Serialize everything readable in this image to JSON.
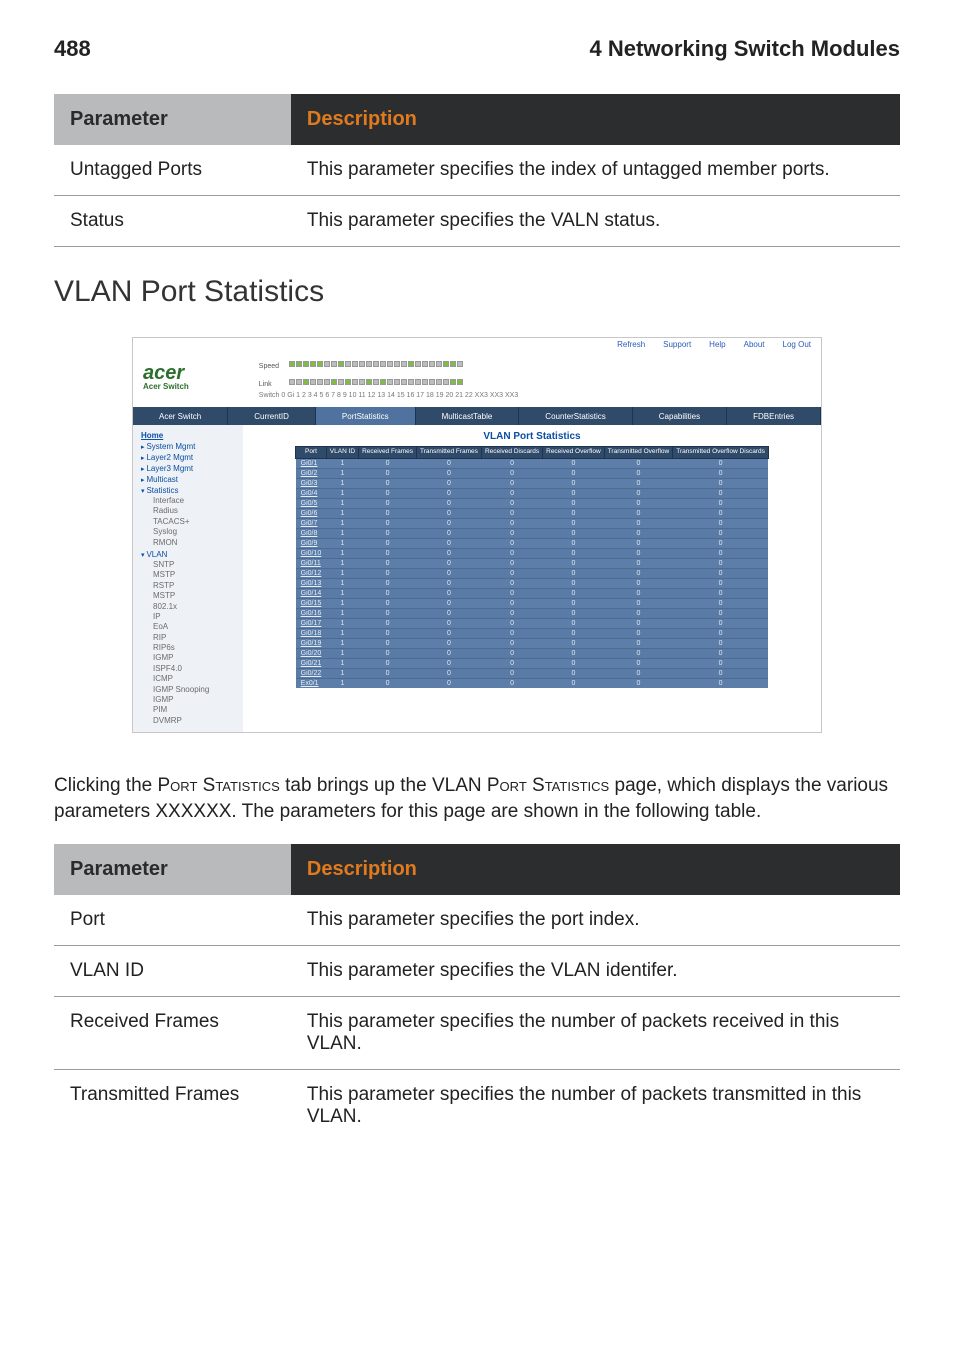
{
  "header": {
    "page_no": "488",
    "chapter": "4 Networking Switch Modules"
  },
  "table1": {
    "head_param": "Parameter",
    "head_desc": "Description",
    "rows": [
      {
        "param": "Untagged Ports",
        "desc": "This parameter specifies the index of untagged member ports."
      },
      {
        "param": "Status",
        "desc": "This parameter specifies the VALN status."
      }
    ]
  },
  "section_heading": "VLAN Port Statistics",
  "shot": {
    "toplinks": [
      {
        "label": "Refresh"
      },
      {
        "label": "Support"
      },
      {
        "label": "Help"
      },
      {
        "label": "About"
      },
      {
        "label": "Log Out"
      }
    ],
    "brand": "acer",
    "brand_sub": "Acer Switch",
    "pp_labels": {
      "speed": "Speed",
      "link": "Link"
    },
    "switch_line": "Switch 0 Gi 1 2 3 4 5 6 7 8 9 10 11 12 13 14 15 16 17 18 19 20 21 22 XX3 XX3 XX3",
    "tabs": [
      "Acer Switch",
      "CurrentID",
      "PortStatistics",
      "MulticastTable",
      "CounterStatistics",
      "Capabilities",
      "FDBEntries"
    ],
    "sidebar": {
      "home": "Home",
      "groups": [
        {
          "label": "System Mgmt"
        },
        {
          "label": "Layer2 Mgmt"
        },
        {
          "label": "Layer3 Mgmt"
        },
        {
          "label": "Multicast"
        },
        {
          "label": "Statistics",
          "open": true,
          "items": [
            "Interface",
            "Radius",
            "TACACS+",
            "Syslog",
            "RMON"
          ]
        },
        {
          "label": "VLAN",
          "open": true,
          "items": [
            "SNTP",
            "MSTP",
            "RSTP",
            "MSTP",
            "802.1x",
            "IP",
            "EoA",
            "RIP",
            "RIP6s",
            "IGMP",
            "ISPF4.0",
            "ICMP",
            "IGMP Snooping",
            "IGMP",
            "PIM",
            "DVMRP"
          ]
        }
      ]
    },
    "main": {
      "title": "VLAN Port Statistics",
      "headers": [
        "Port",
        "VLAN ID",
        "Received Frames",
        "Transmitted Frames",
        "Received Discards",
        "Received Overflow",
        "Transmitted Overflow",
        "Transmitted Overflow Discards"
      ],
      "rows": [
        {
          "port": "Gi0/1",
          "id": "1",
          "v": [
            "0",
            "0",
            "0",
            "0",
            "0",
            "0"
          ]
        },
        {
          "port": "Gi0/2",
          "id": "1",
          "v": [
            "0",
            "0",
            "0",
            "0",
            "0",
            "0"
          ]
        },
        {
          "port": "Gi0/3",
          "id": "1",
          "v": [
            "0",
            "0",
            "0",
            "0",
            "0",
            "0"
          ]
        },
        {
          "port": "Gi0/4",
          "id": "1",
          "v": [
            "0",
            "0",
            "0",
            "0",
            "0",
            "0"
          ]
        },
        {
          "port": "Gi0/5",
          "id": "1",
          "v": [
            "0",
            "0",
            "0",
            "0",
            "0",
            "0"
          ]
        },
        {
          "port": "Gi0/6",
          "id": "1",
          "v": [
            "0",
            "0",
            "0",
            "0",
            "0",
            "0"
          ]
        },
        {
          "port": "Gi0/7",
          "id": "1",
          "v": [
            "0",
            "0",
            "0",
            "0",
            "0",
            "0"
          ]
        },
        {
          "port": "Gi0/8",
          "id": "1",
          "v": [
            "0",
            "0",
            "0",
            "0",
            "0",
            "0"
          ]
        },
        {
          "port": "Gi0/9",
          "id": "1",
          "v": [
            "0",
            "0",
            "0",
            "0",
            "0",
            "0"
          ]
        },
        {
          "port": "Gi0/10",
          "id": "1",
          "v": [
            "0",
            "0",
            "0",
            "0",
            "0",
            "0"
          ]
        },
        {
          "port": "Gi0/11",
          "id": "1",
          "v": [
            "0",
            "0",
            "0",
            "0",
            "0",
            "0"
          ]
        },
        {
          "port": "Gi0/12",
          "id": "1",
          "v": [
            "0",
            "0",
            "0",
            "0",
            "0",
            "0"
          ]
        },
        {
          "port": "Gi0/13",
          "id": "1",
          "v": [
            "0",
            "0",
            "0",
            "0",
            "0",
            "0"
          ]
        },
        {
          "port": "Gi0/14",
          "id": "1",
          "v": [
            "0",
            "0",
            "0",
            "0",
            "0",
            "0"
          ]
        },
        {
          "port": "Gi0/15",
          "id": "1",
          "v": [
            "0",
            "0",
            "0",
            "0",
            "0",
            "0"
          ]
        },
        {
          "port": "Gi0/16",
          "id": "1",
          "v": [
            "0",
            "0",
            "0",
            "0",
            "0",
            "0"
          ]
        },
        {
          "port": "Gi0/17",
          "id": "1",
          "v": [
            "0",
            "0",
            "0",
            "0",
            "0",
            "0"
          ]
        },
        {
          "port": "Gi0/18",
          "id": "1",
          "v": [
            "0",
            "0",
            "0",
            "0",
            "0",
            "0"
          ]
        },
        {
          "port": "Gi0/19",
          "id": "1",
          "v": [
            "0",
            "0",
            "0",
            "0",
            "0",
            "0"
          ]
        },
        {
          "port": "Gi0/20",
          "id": "1",
          "v": [
            "0",
            "0",
            "0",
            "0",
            "0",
            "0"
          ]
        },
        {
          "port": "Gi0/21",
          "id": "1",
          "v": [
            "0",
            "0",
            "0",
            "0",
            "0",
            "0"
          ]
        },
        {
          "port": "Gi0/22",
          "id": "1",
          "v": [
            "0",
            "0",
            "0",
            "0",
            "0",
            "0"
          ]
        },
        {
          "port": "Ex0/1",
          "id": "1",
          "v": [
            "0",
            "0",
            "0",
            "0",
            "0",
            "0"
          ]
        }
      ]
    }
  },
  "body_para": {
    "pre": "Clicking the ",
    "sc1": "Port Statistics",
    "mid1": " tab brings up the VLAN ",
    "sc2": "Port Statistics",
    "post": " page, which displays the various parameters XXXXXX. The parameters for this page are shown in the following table."
  },
  "table2": {
    "head_param": "Parameter",
    "head_desc": "Description",
    "rows": [
      {
        "param": "Port",
        "desc": "This parameter specifies the port index."
      },
      {
        "param": "VLAN ID",
        "desc": "This parameter specifies the VLAN identifer."
      },
      {
        "param": "Received Frames",
        "desc": "This parameter specifies the number of packets received in this VLAN."
      },
      {
        "param": "Transmitted Frames",
        "desc": "This parameter specifies the number of packets transmitted in this VLAN."
      }
    ]
  }
}
